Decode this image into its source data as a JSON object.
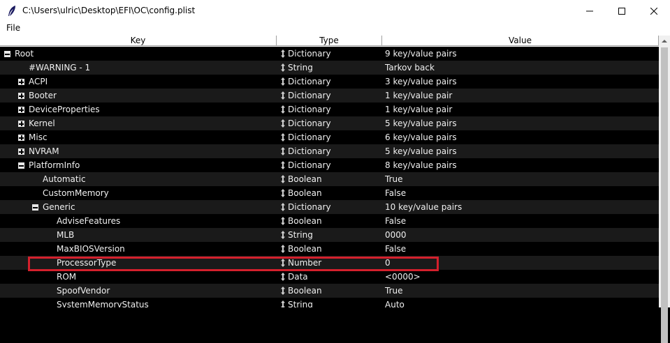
{
  "window": {
    "title": "C:\\Users\\ulric\\Desktop\\EFI\\OC\\config.plist",
    "minimize_symbol": "—",
    "maximize_symbol": "☐",
    "close_symbol": "✕",
    "app_icon": "feather-icon"
  },
  "menu": {
    "file": "File"
  },
  "columns": {
    "key": "Key",
    "type": "Type",
    "value": "Value"
  },
  "rows": [
    {
      "key": "Root",
      "type": "Dictionary",
      "value": "9 key/value pairs",
      "depth": 0,
      "toggle": "minus"
    },
    {
      "key": "#WARNING - 1",
      "type": "String",
      "value": "Tarkov back",
      "depth": 1,
      "toggle": "none"
    },
    {
      "key": "ACPI",
      "type": "Dictionary",
      "value": "3 key/value pairs",
      "depth": 1,
      "toggle": "plus"
    },
    {
      "key": "Booter",
      "type": "Dictionary",
      "value": "1 key/value pair",
      "depth": 1,
      "toggle": "plus"
    },
    {
      "key": "DeviceProperties",
      "type": "Dictionary",
      "value": "1 key/value pair",
      "depth": 1,
      "toggle": "plus"
    },
    {
      "key": "Kernel",
      "type": "Dictionary",
      "value": "5 key/value pairs",
      "depth": 1,
      "toggle": "plus"
    },
    {
      "key": "Misc",
      "type": "Dictionary",
      "value": "6 key/value pairs",
      "depth": 1,
      "toggle": "plus"
    },
    {
      "key": "NVRAM",
      "type": "Dictionary",
      "value": "5 key/value pairs",
      "depth": 1,
      "toggle": "plus"
    },
    {
      "key": "PlatformInfo",
      "type": "Dictionary",
      "value": "8 key/value pairs",
      "depth": 1,
      "toggle": "minus"
    },
    {
      "key": "Automatic",
      "type": "Boolean",
      "value": "True",
      "depth": 2,
      "toggle": "none"
    },
    {
      "key": "CustomMemory",
      "type": "Boolean",
      "value": "False",
      "depth": 2,
      "toggle": "none"
    },
    {
      "key": "Generic",
      "type": "Dictionary",
      "value": "10 key/value pairs",
      "depth": 2,
      "toggle": "minus"
    },
    {
      "key": "AdviseFeatures",
      "type": "Boolean",
      "value": "False",
      "depth": 3,
      "toggle": "none"
    },
    {
      "key": "MLB",
      "type": "String",
      "value": "0000",
      "depth": 3,
      "toggle": "none"
    },
    {
      "key": "MaxBIOSVersion",
      "type": "Boolean",
      "value": "False",
      "depth": 3,
      "toggle": "none"
    },
    {
      "key": "ProcessorType",
      "type": "Number",
      "value": "0",
      "depth": 3,
      "toggle": "none"
    },
    {
      "key": "ROM",
      "type": "Data",
      "value": "<0000>",
      "depth": 3,
      "toggle": "none"
    },
    {
      "key": "SpoofVendor",
      "type": "Boolean",
      "value": "True",
      "depth": 3,
      "toggle": "none"
    },
    {
      "key": "SystemMemoryStatus",
      "type": "String",
      "value": "Auto",
      "depth": 3,
      "toggle": "none"
    }
  ],
  "colors": {
    "highlight": "#d4202c",
    "row_odd": "#000000",
    "row_even": "#1a1a1a",
    "text": "#f0f0f0"
  }
}
